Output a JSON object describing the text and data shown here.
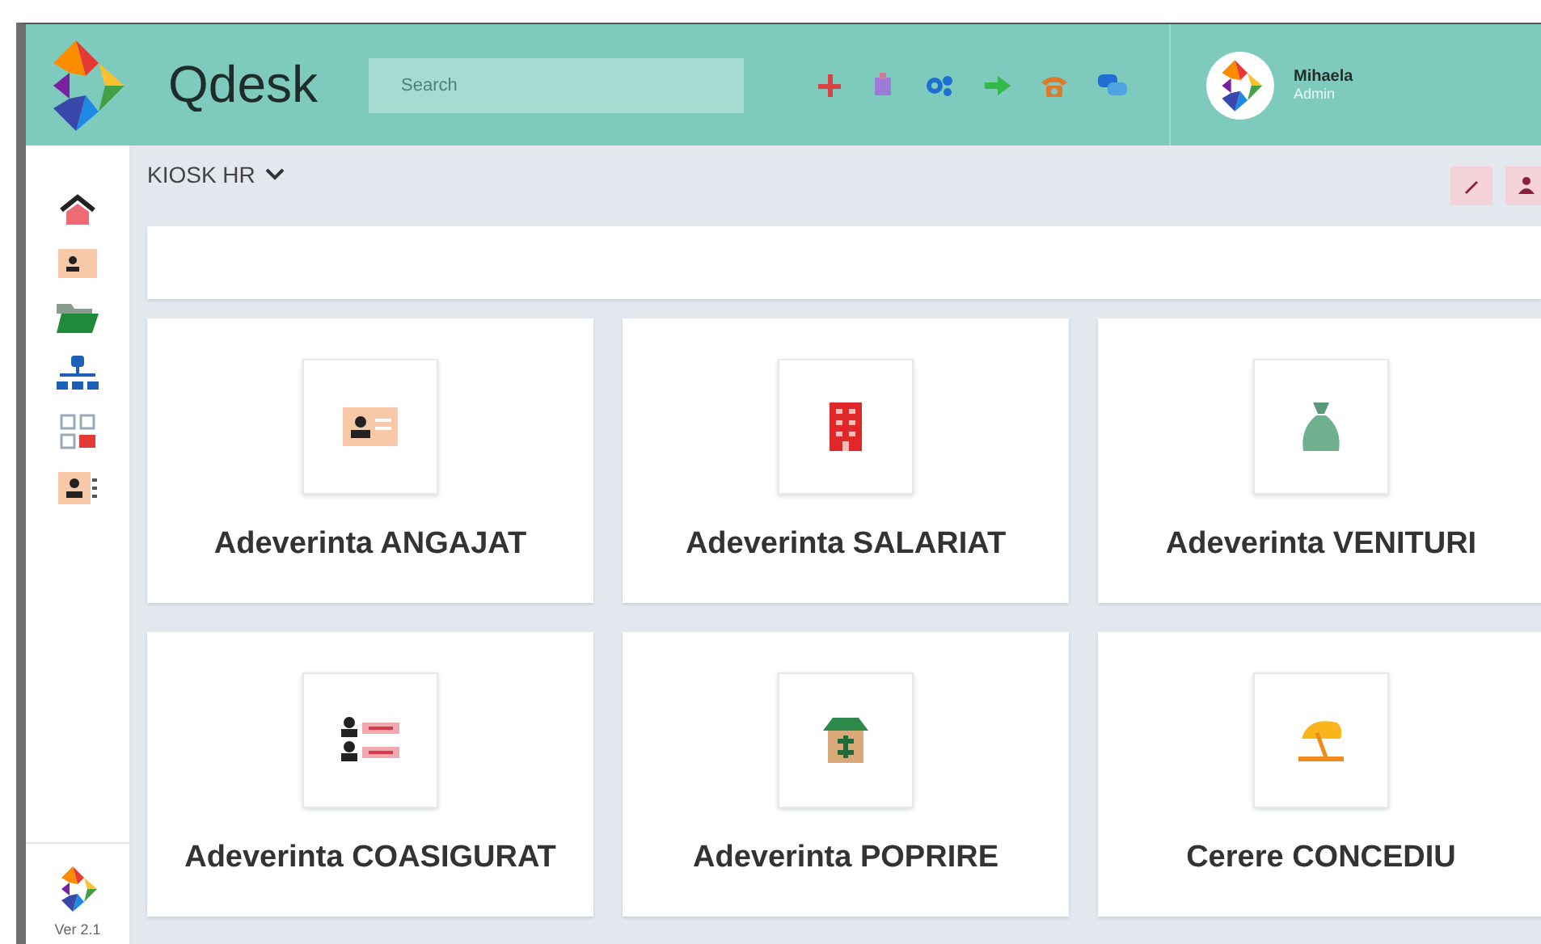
{
  "header": {
    "title": "Qdesk",
    "search": {
      "placeholder": "Search"
    },
    "user": {
      "name": "Mihaela",
      "role": "Admin"
    }
  },
  "sidebar": {
    "version": "Ver 2.1"
  },
  "module": {
    "title": "KIOSK HR"
  },
  "cards": [
    {
      "label": "Adeverinta ANGAJAT",
      "kind": "idcard"
    },
    {
      "label": "Adeverinta SALARIAT",
      "kind": "building"
    },
    {
      "label": "Adeverinta VENITURI",
      "kind": "moneybag"
    },
    {
      "label": "Adeverinta COASIGURAT",
      "kind": "people"
    },
    {
      "label": "Adeverinta POPRIRE",
      "kind": "box"
    },
    {
      "label": "Cerere CONCEDIU",
      "kind": "umbrella"
    }
  ]
}
